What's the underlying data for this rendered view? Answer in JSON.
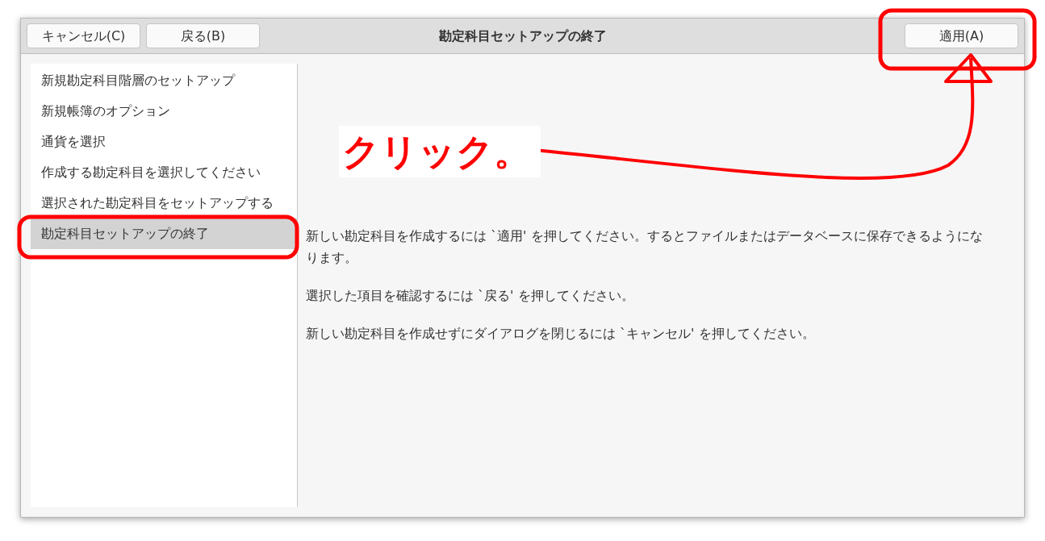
{
  "window": {
    "title": "勘定科目セットアップの終了"
  },
  "header_buttons_left": [
    {
      "label": "キャンセル(C)"
    },
    {
      "label": "戻る(B)"
    }
  ],
  "header_buttons_right": [
    {
      "label": "適用(A)"
    }
  ],
  "sidebar": {
    "items": [
      {
        "label": "新規勘定科目階層のセットアップ",
        "selected": false
      },
      {
        "label": "新規帳簿のオプション",
        "selected": false
      },
      {
        "label": "通貨を選択",
        "selected": false
      },
      {
        "label": "作成する勘定科目を選択してください",
        "selected": false
      },
      {
        "label": "選択された勘定科目をセットアップする",
        "selected": false
      },
      {
        "label": "勘定科目セットアップの終了",
        "selected": true
      }
    ]
  },
  "content": {
    "paragraphs": [
      "新しい勘定科目を作成するには `適用' を押してください。するとファイルまたはデータベースに保存できるようになります。",
      "選択した項目を確認するには `戻る' を押してください。",
      "新しい勘定科目を作成せずにダイアログを閉じるには `キャンセル' を押してください。"
    ]
  },
  "annotation": {
    "label": "クリック。"
  }
}
